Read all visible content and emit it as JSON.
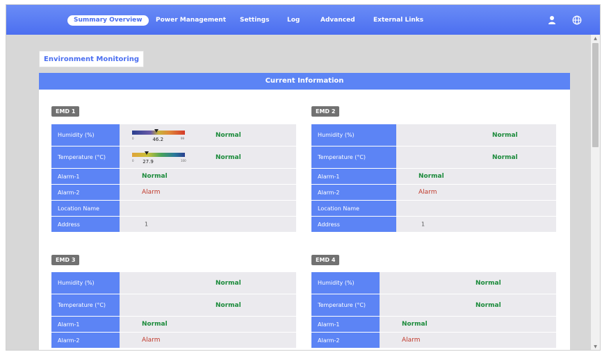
{
  "nav": {
    "items": [
      "Summary Overview",
      "Power Management",
      "Settings",
      "Log",
      "Advanced",
      "External Links"
    ],
    "active": "Summary Overview",
    "icons": [
      "user-icon",
      "globe-icon"
    ]
  },
  "section_tab": "Environment Monitoring",
  "panel_title": "Current Information",
  "row_labels": {
    "humidity": "Humidity (%)",
    "temperature": "Temperature (°C)",
    "alarm1": "Alarm-1",
    "alarm2": "Alarm-2",
    "location": "Location Name",
    "address": "Address"
  },
  "emd": [
    {
      "name": "EMD 1",
      "humidity": {
        "value": "46.2",
        "min": "0",
        "max": "99",
        "status": "Normal"
      },
      "temperature": {
        "value": "27.9",
        "min": "0",
        "max": "100",
        "status": "Normal"
      },
      "alarm1": "Normal",
      "alarm2": "Alarm",
      "location": "",
      "address": "1"
    },
    {
      "name": "EMD 2",
      "humidity": {
        "status": "Normal"
      },
      "temperature": {
        "status": "Normal"
      },
      "alarm1": "Normal",
      "alarm2": "Alarm",
      "location": "",
      "address": "1"
    },
    {
      "name": "EMD 3",
      "humidity": {
        "status": "Normal"
      },
      "temperature": {
        "status": "Normal"
      },
      "alarm1": "Normal",
      "alarm2": "Alarm"
    },
    {
      "name": "EMD 4",
      "humidity": {
        "status": "Normal"
      },
      "temperature": {
        "status": "Normal"
      },
      "alarm1": "Normal",
      "alarm2": "Alarm"
    }
  ],
  "colors": {
    "nav_bg": "#5577f2",
    "label_bg": "#5c84f5",
    "value_bg": "#ebeaee",
    "normal": "#1a8a3a",
    "alarm": "#c0392b",
    "emd_badge": "#717171"
  }
}
